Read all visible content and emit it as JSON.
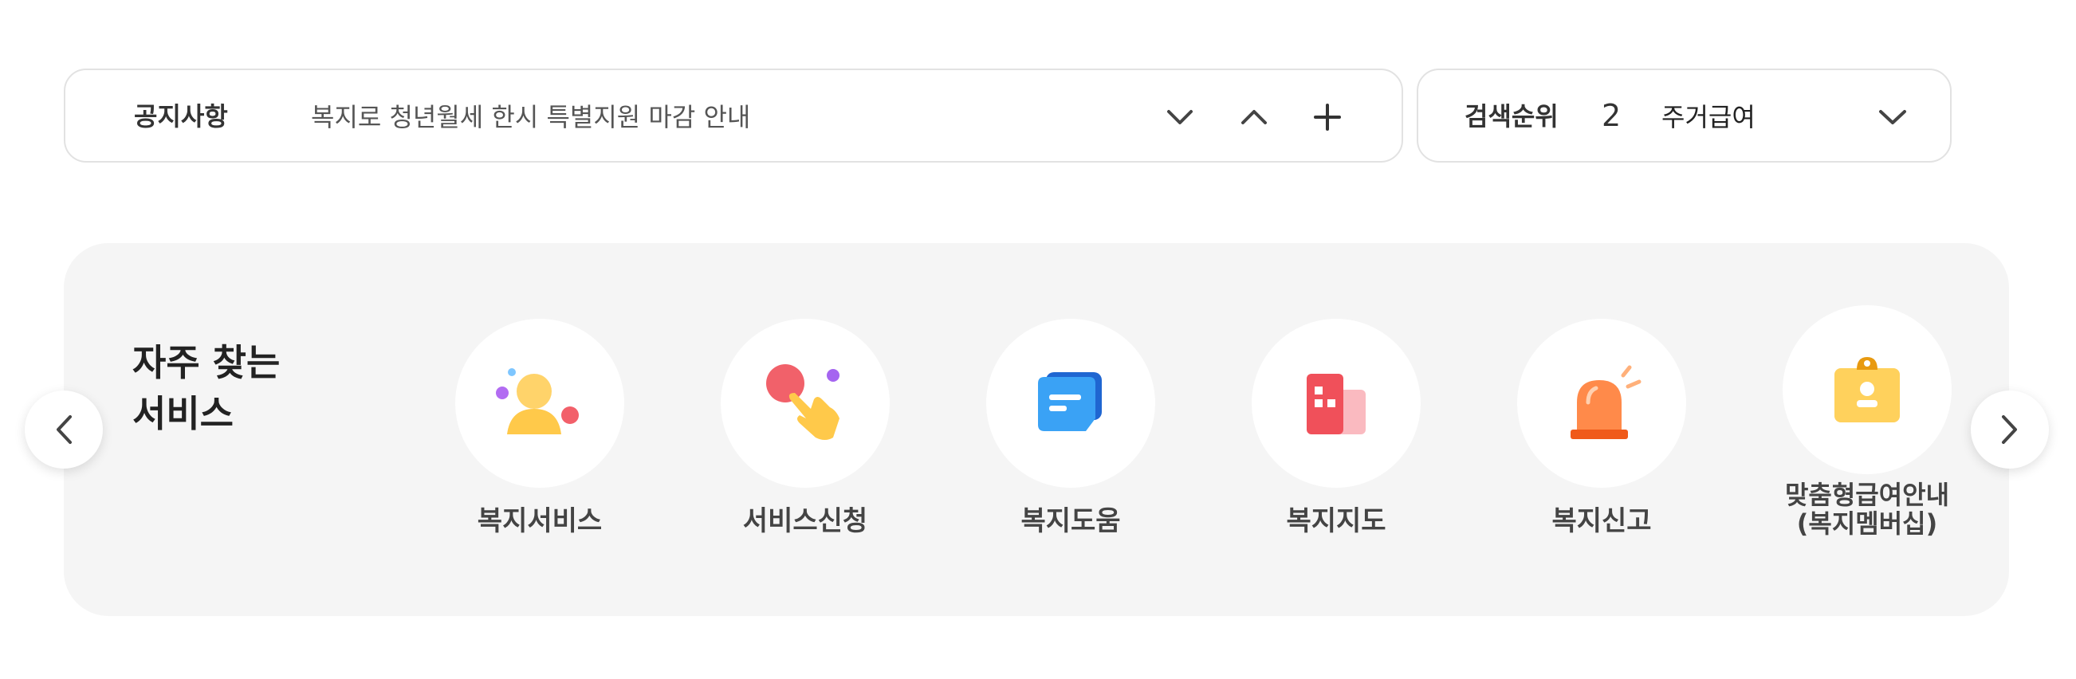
{
  "notice": {
    "label": "공지사항",
    "text": "복지로 청년월세 한시 특별지원 마감 안내",
    "controls": [
      {
        "name": "notice-next-button",
        "icon": "chevron-down-icon"
      },
      {
        "name": "notice-prev-button",
        "icon": "chevron-up-icon"
      },
      {
        "name": "notice-more-button",
        "icon": "plus-icon"
      }
    ]
  },
  "search_rank": {
    "label": "검색순위",
    "rank": "2",
    "term": "주거급여",
    "toggle_icon": "chevron-down-icon"
  },
  "services": {
    "title_line1": "자주 찾는",
    "title_line2": "서비스",
    "items": [
      {
        "label": "복지서비스",
        "icon": "person-icon"
      },
      {
        "label": "서비스신청",
        "icon": "tap-hand-icon"
      },
      {
        "label": "복지도움",
        "icon": "chat-bubble-icon"
      },
      {
        "label": "복지지도",
        "icon": "map-building-icon"
      },
      {
        "label": "복지신고",
        "icon": "siren-icon"
      },
      {
        "label_line1": "맞춤형급여안내",
        "label_line2": "(복지멤버십)",
        "icon": "id-badge-icon"
      }
    ],
    "prev_icon": "chevron-left-icon",
    "next_icon": "chevron-right-icon"
  },
  "colors": {
    "panel_bg": "#f5f5f5",
    "border": "#e2e2e2",
    "yellow": "#ffc94a",
    "red": "#f0505a",
    "blue": "#2f8df0",
    "orange": "#ff6a2e",
    "purple": "#a565f0"
  }
}
